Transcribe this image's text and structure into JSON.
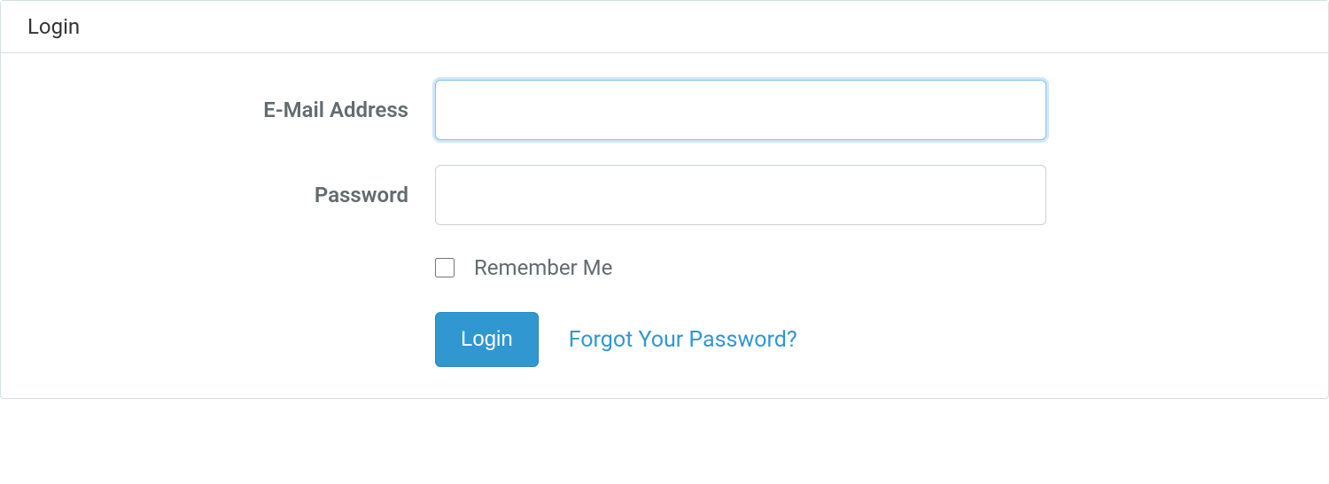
{
  "panel": {
    "title": "Login"
  },
  "form": {
    "email_label": "E-Mail Address",
    "email_value": "",
    "password_label": "Password",
    "password_value": "",
    "remember_label": "Remember Me",
    "submit_label": "Login",
    "forgot_link_label": "Forgot Your Password?"
  }
}
